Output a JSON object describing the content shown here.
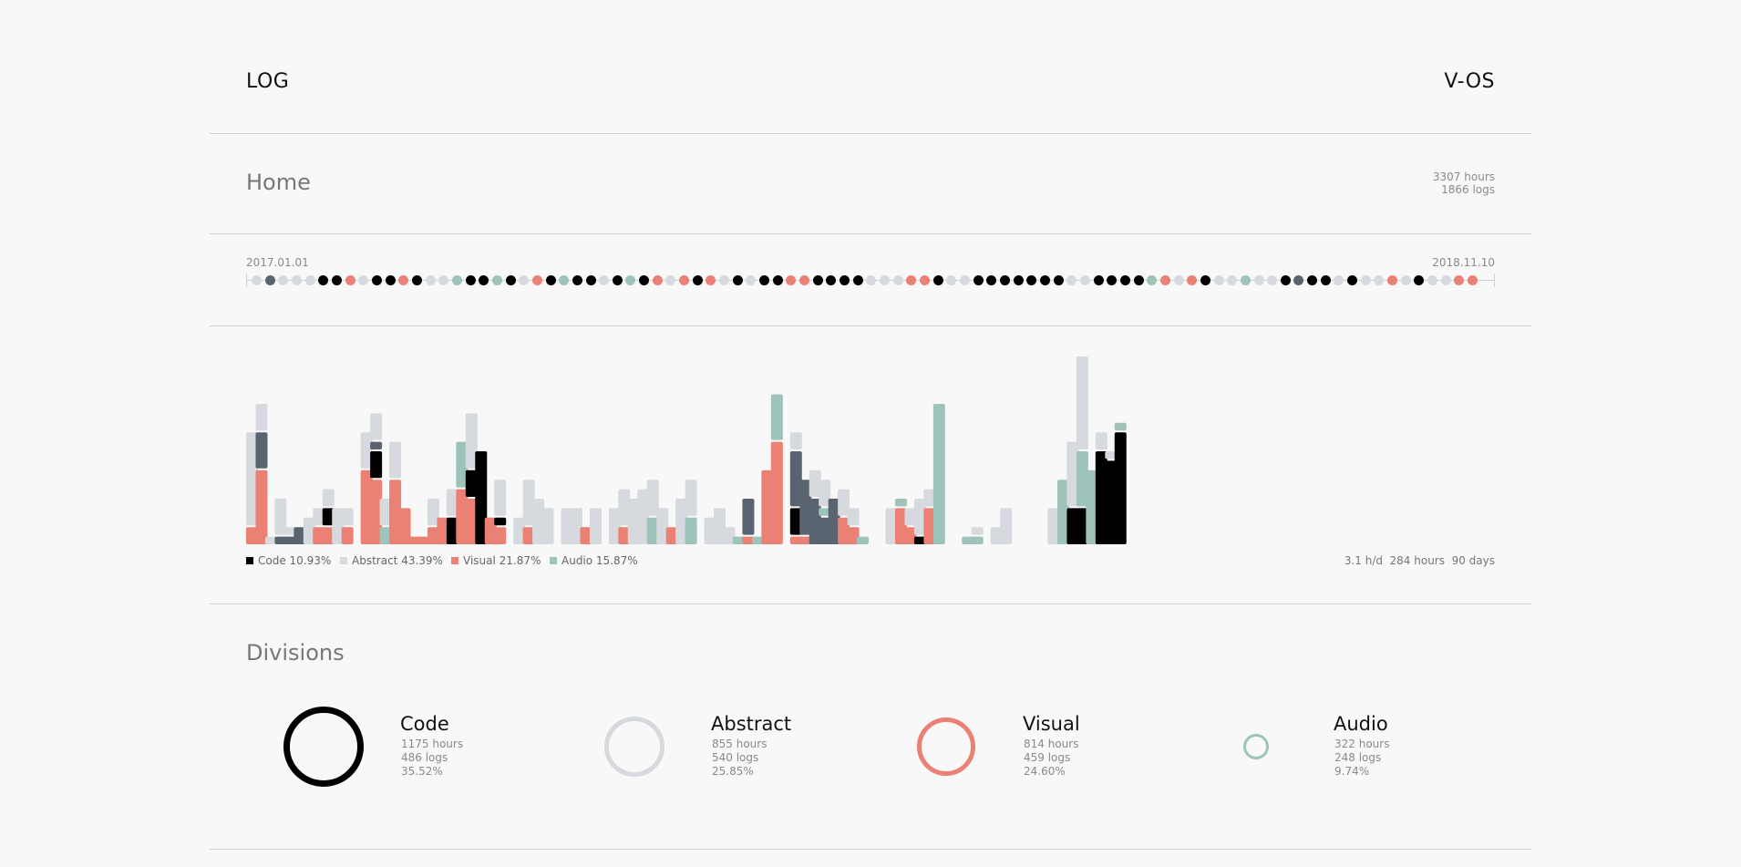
{
  "header": {
    "brand": "LOG",
    "os_title": "V-OS"
  },
  "home": {
    "title": "Home",
    "hours": "3307 hours",
    "logs": "1866 logs"
  },
  "timeline": {
    "start": "2017.01.01",
    "end": "2018.11.10",
    "dots": [
      "a",
      "d",
      "a",
      "a",
      "a",
      "c",
      "c",
      "v",
      "a",
      "c",
      "c",
      "v",
      "c",
      "a",
      "a",
      "u",
      "c",
      "c",
      "u",
      "c",
      "a",
      "v",
      "c",
      "u",
      "c",
      "c",
      "a",
      "c",
      "u",
      "c",
      "v",
      "a",
      "v",
      "c",
      "v",
      "a",
      "c",
      "a",
      "c",
      "c",
      "v",
      "v",
      "c",
      "c",
      "c",
      "c",
      "a",
      "a",
      "a",
      "v",
      "v",
      "c",
      "a",
      "a",
      "c",
      "c",
      "c",
      "c",
      "c",
      "c",
      "c",
      "a",
      "a",
      "c",
      "c",
      "c",
      "c",
      "u",
      "v",
      "a",
      "v",
      "c",
      "a",
      "a",
      "u",
      "a",
      "a",
      "c",
      "d",
      "c",
      "c",
      "a",
      "c",
      "a",
      "a",
      "v",
      "a",
      "c",
      "a",
      "a",
      "v",
      "v"
    ]
  },
  "chart_data": {
    "type": "bar",
    "stacked": true,
    "series": [
      {
        "name": "Code",
        "values": [
          0,
          0,
          0,
          0,
          0,
          0,
          0,
          0,
          2,
          0,
          0,
          0,
          0,
          3,
          0,
          0,
          0,
          0,
          0,
          0,
          0,
          3,
          0,
          3,
          10,
          0,
          1,
          0,
          0,
          0,
          0,
          0,
          0,
          0,
          0,
          0,
          0,
          0,
          0,
          0,
          0,
          0,
          0,
          0,
          0,
          0,
          0,
          0,
          0,
          0,
          0,
          0,
          0,
          0,
          0,
          0,
          0,
          3,
          0,
          0,
          0,
          0,
          0,
          0,
          0,
          0,
          0,
          0,
          0,
          0,
          1,
          0,
          0,
          0,
          0,
          0,
          0,
          0,
          0,
          0,
          0,
          0,
          0,
          0,
          0,
          0,
          4,
          4,
          0,
          10,
          9,
          12
        ]
      },
      {
        "name": "Abstract",
        "values": [
          10,
          3,
          1,
          4,
          1,
          0,
          3,
          2,
          2,
          4,
          2,
          0,
          4,
          3,
          3,
          4,
          0,
          0,
          0,
          3,
          0,
          3,
          0,
          6,
          0,
          0,
          4,
          0,
          3,
          5,
          5,
          4,
          0,
          4,
          4,
          0,
          4,
          0,
          4,
          4,
          5,
          6,
          4,
          4,
          0,
          5,
          4,
          0,
          3,
          4,
          2,
          0,
          0,
          0,
          0,
          0,
          0,
          2,
          0,
          3,
          3,
          0,
          3,
          2,
          0,
          0,
          0,
          4,
          0,
          2,
          4,
          2,
          0,
          0,
          0,
          0,
          1,
          0,
          2,
          4,
          0,
          0,
          0,
          0,
          4,
          0,
          7,
          10,
          0,
          2,
          1,
          0
        ]
      },
      {
        "name": "Visual",
        "values": [
          2,
          8,
          0,
          0,
          0,
          0,
          0,
          2,
          2,
          0,
          2,
          0,
          8,
          7,
          0,
          7,
          4,
          1,
          1,
          2,
          3,
          0,
          6,
          5,
          0,
          3,
          2,
          0,
          0,
          2,
          0,
          0,
          0,
          0,
          0,
          2,
          0,
          0,
          0,
          2,
          0,
          0,
          0,
          0,
          2,
          0,
          0,
          0,
          0,
          0,
          0,
          0,
          1,
          0,
          8,
          11,
          0,
          1,
          1,
          0,
          0,
          0,
          3,
          2,
          0,
          0,
          0,
          0,
          4,
          2,
          0,
          4,
          0,
          0,
          0,
          0,
          0,
          0,
          0,
          0,
          0,
          0,
          0,
          0,
          0,
          0,
          0,
          0,
          0,
          0,
          0,
          0
        ]
      },
      {
        "name": "Audio",
        "values": [
          0,
          0,
          0,
          0,
          0,
          0,
          0,
          0,
          0,
          0,
          0,
          0,
          0,
          0,
          2,
          0,
          0,
          0,
          0,
          0,
          0,
          0,
          5,
          0,
          0,
          0,
          0,
          0,
          0,
          0,
          0,
          0,
          0,
          0,
          0,
          0,
          0,
          0,
          0,
          0,
          0,
          0,
          3,
          0,
          0,
          0,
          3,
          0,
          0,
          0,
          0,
          1,
          0,
          1,
          0,
          5,
          0,
          0,
          0,
          0,
          1,
          0,
          0,
          0,
          1,
          0,
          0,
          0,
          1,
          0,
          0,
          0,
          15,
          0,
          0,
          1,
          1,
          0,
          0,
          0,
          0,
          0,
          0,
          0,
          0,
          7,
          0,
          6,
          8,
          0,
          0,
          1
        ]
      }
    ],
    "extra_series": {
      "name": "Other",
      "values": [
        0,
        4,
        0,
        1,
        1,
        2,
        0,
        0,
        0,
        0,
        0,
        0,
        0,
        1,
        0,
        0,
        0,
        0,
        0,
        0,
        0,
        0,
        0,
        0,
        0,
        0,
        0,
        0,
        0,
        0,
        0,
        0,
        0,
        0,
        0,
        0,
        0,
        0,
        0,
        0,
        0,
        0,
        0,
        0,
        0,
        0,
        0,
        0,
        0,
        0,
        0,
        0,
        4,
        0,
        0,
        0,
        0,
        6,
        6,
        5,
        3,
        5,
        0,
        0,
        0,
        0,
        0,
        0,
        0,
        0,
        0,
        0,
        0,
        0,
        0,
        0,
        0,
        0,
        0,
        0,
        0,
        0,
        0,
        0,
        0,
        0,
        0,
        0,
        0,
        0,
        0,
        0
      ]
    },
    "legend": [
      "Code 10.93%",
      "Abstract 43.39%",
      "Visual 21.87%",
      "Audio 15.87%"
    ],
    "grid": false,
    "legend_position": "bottom-left"
  },
  "chart_stats": {
    "hours_per_day": "3.1 h/d",
    "hours": "284 hours",
    "days": "90 days"
  },
  "colors": {
    "code": "#000000",
    "abstract": "#d6d9dd",
    "visual": "#ea8174",
    "audio": "#9dc3ba",
    "other": "#5a6470"
  },
  "divisions": {
    "title": "Divisions",
    "items": [
      {
        "name": "Code",
        "hours": "1175 hours",
        "logs": "486 logs",
        "percent": "35.52%",
        "share": 35.52
      },
      {
        "name": "Abstract",
        "hours": "855 hours",
        "logs": "540 logs",
        "percent": "25.85%",
        "share": 25.85
      },
      {
        "name": "Visual",
        "hours": "814 hours",
        "logs": "459 logs",
        "percent": "24.60%",
        "share": 24.6
      },
      {
        "name": "Audio",
        "hours": "322 hours",
        "logs": "248 logs",
        "percent": "9.74%",
        "share": 9.74
      }
    ]
  }
}
